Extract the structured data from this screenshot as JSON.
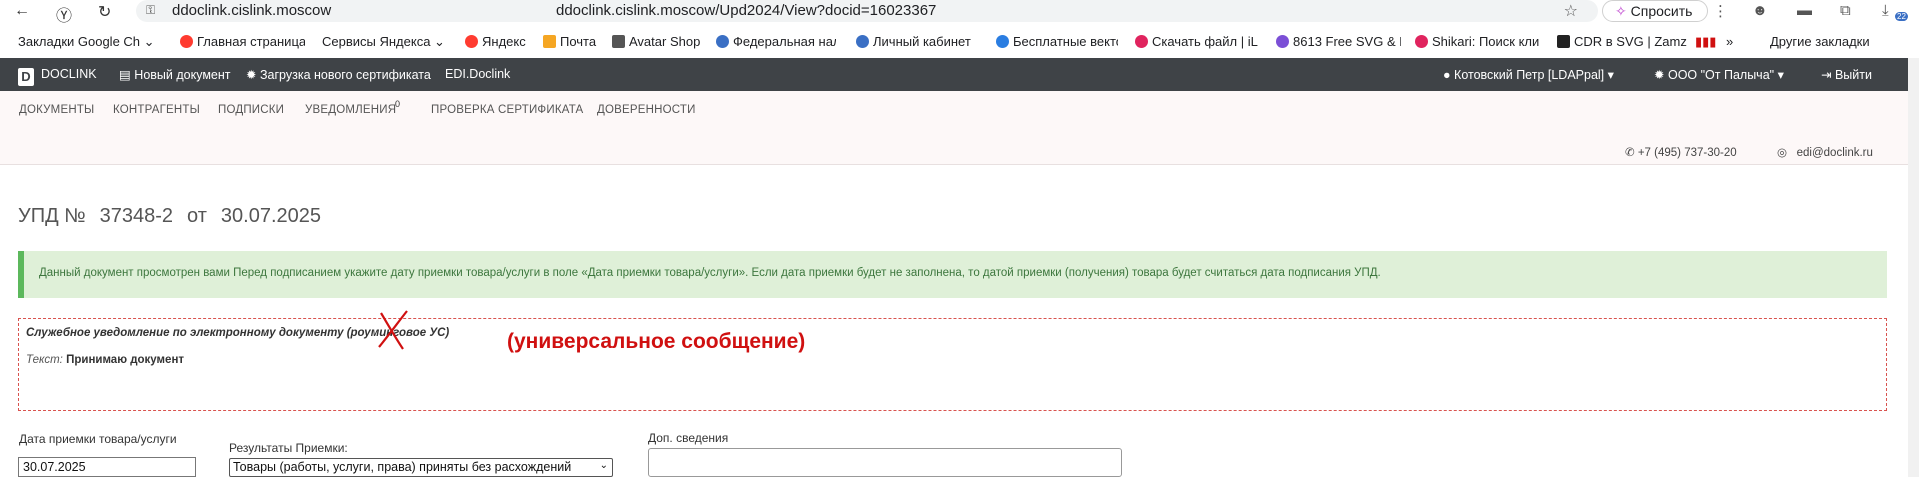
{
  "browser": {
    "host": "ddoclink.cislink.moscow",
    "url": "ddoclink.cislink.moscow/Upd2024/View?docid=16023367",
    "ask_label": "Спросить",
    "ext_badge": "22"
  },
  "bookmarks": [
    {
      "label": "Закладки Google Ch",
      "color": "#ffffff"
    },
    {
      "label": "Главная страница",
      "color": "#ff3b30"
    },
    {
      "label": "Сервисы Яндекса",
      "color": "#ffffff"
    },
    {
      "label": "Яндекс",
      "color": "#ff3b30"
    },
    {
      "label": "Почта",
      "color": "#f5a623"
    },
    {
      "label": "Avatar Shop",
      "color": "#555555"
    },
    {
      "label": "Федеральная нал",
      "color": "#3a6fc4"
    },
    {
      "label": "Личный кабинет",
      "color": "#3a6fc4"
    },
    {
      "label": "Бесплатные векто",
      "color": "#2a7de1"
    },
    {
      "label": "Скачать файл | iL",
      "color": "#e0245e"
    },
    {
      "label": "8613 Free SVG & F",
      "color": "#7b4fd6"
    },
    {
      "label": "Shikari: Поиск кли",
      "color": "#e0245e"
    },
    {
      "label": "CDR в SVG | Zamz",
      "color": "#222222"
    }
  ],
  "bookmarks_other": "Другие закладки",
  "topbar": {
    "logo_letter": "D",
    "brand": "DOCLINK",
    "new_doc": "Новый документ",
    "upload_cert": "Загрузка нового сертификата",
    "edi": "EDI.Doclink",
    "user": "Котовский Петр [LDAPpal]",
    "org": "ООО \"От Палыча\"",
    "logout": "Выйти"
  },
  "menu": {
    "documents": "ДОКУМЕНТЫ",
    "contractors": "КОНТРАГЕНТЫ",
    "subscriptions": "ПОДПИСКИ",
    "notifications": "УВЕДОМЛЕНИЯ",
    "notifications_count": "0",
    "check_cert": "ПРОВЕРКА СЕРТИФИКАТА",
    "powers": "ДОВЕРЕННОСТИ"
  },
  "contacts": {
    "phone": "+7 (495) 737-30-20",
    "email": "edi@doclink.ru"
  },
  "doc": {
    "type": "УПД №",
    "number": "37348-2",
    "from": "от",
    "date": "30.07.2025"
  },
  "alert": "Данный документ просмотрен вами  Перед подписанием укажите дату приемки товара/услуги в поле «Дата приемки товара/услуги». Если дата приемки будет не заполнена, то датой приемки (получения) товара будет считаться дата подписания УПД.",
  "notice": {
    "title": "Служебное уведомление по электронному документу (роуминговое УС)",
    "text_label": "Текст:",
    "text_value": "Принимаю документ",
    "annotation": "(универсальное сообщение)"
  },
  "form": {
    "accept_date_label": "Дата приемки товара/услуги",
    "accept_date_value": "30.07.2025",
    "results_label": "Результаты Приемки:",
    "results_value": "Товары (работы, услуги, права) приняты без расхождений",
    "extra_label": "Доп. сведения"
  }
}
